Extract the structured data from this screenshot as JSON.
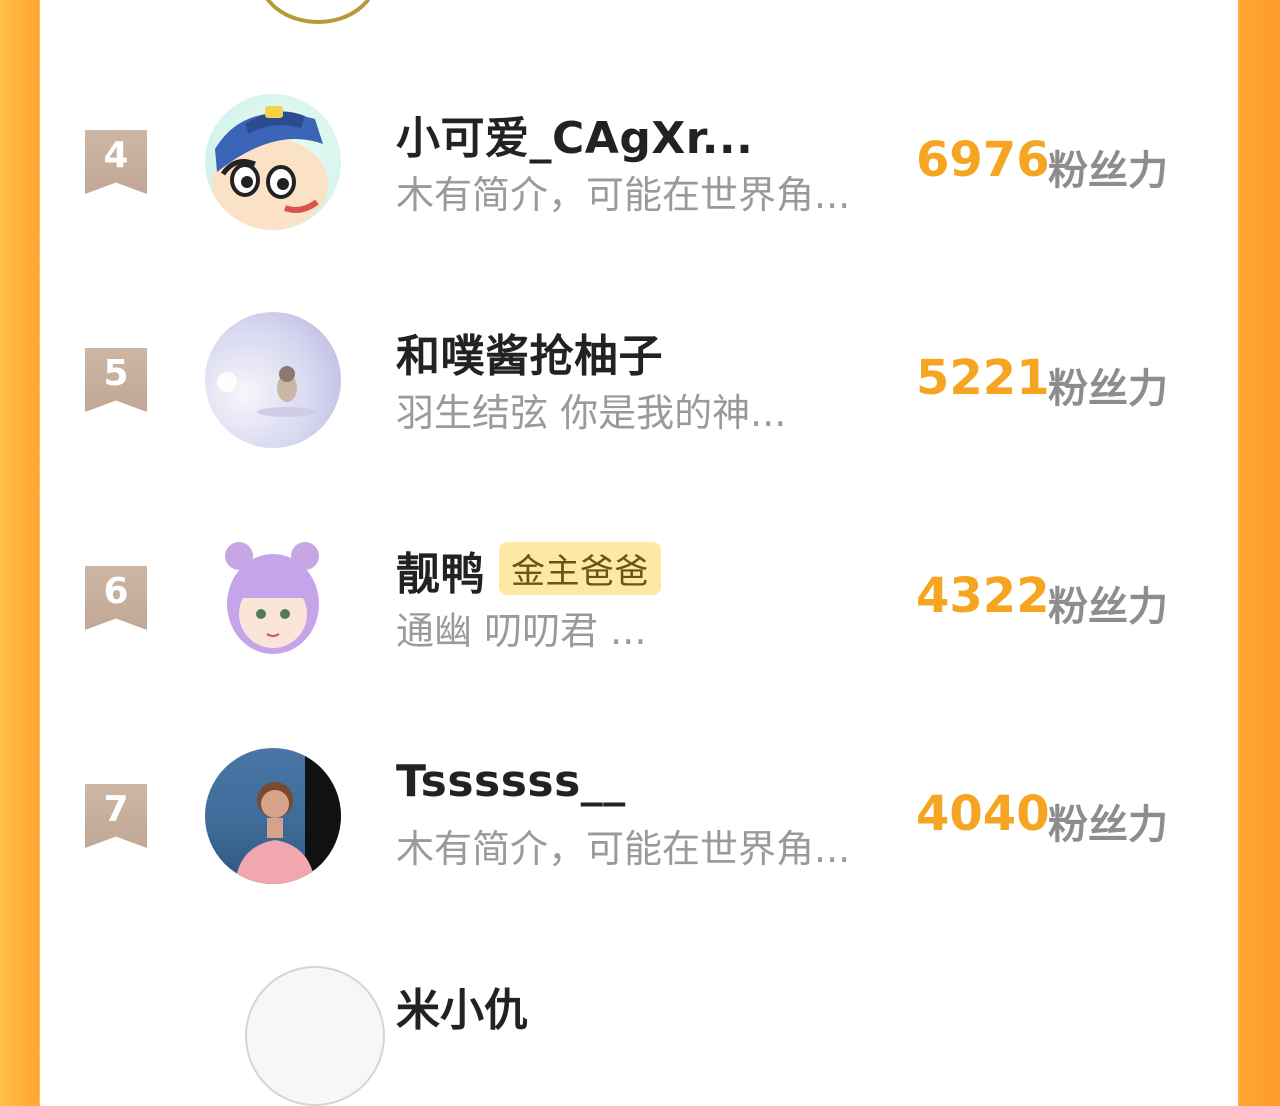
{
  "score_unit": "粉丝力",
  "list": [
    {
      "rank": "4",
      "name": "小可爱_CAgXr...",
      "bio": "木有简介，可能在世界角...",
      "score": "6976",
      "badge": ""
    },
    {
      "rank": "5",
      "name": "和噗酱抢柚子",
      "bio": "羽生结弦 你是我的神...",
      "score": "5221",
      "badge": ""
    },
    {
      "rank": "6",
      "name": "靓鸭",
      "bio": "通幽 叨叨君      ...",
      "score": "4322",
      "badge": "金主爸爸"
    },
    {
      "rank": "7",
      "name": "Tssssss__",
      "bio": "木有简介，可能在世界角...",
      "score": "4040",
      "badge": ""
    }
  ],
  "next_partial_name": "米小仇",
  "colors": {
    "side_orange": "#ffa631",
    "score": "#f5a522",
    "rank_badge": "#c6ae9b",
    "vip_badge_bg": "#fde9a4"
  }
}
